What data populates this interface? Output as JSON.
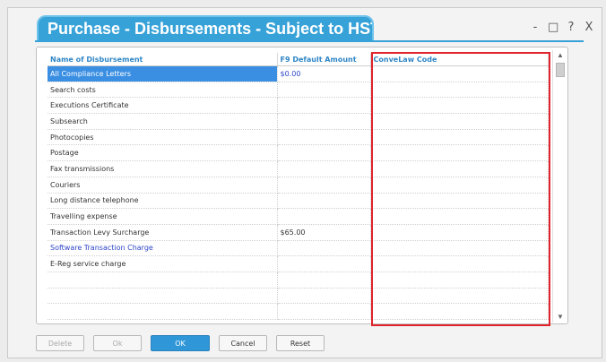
{
  "window": {
    "title": "Purchase - Disbursements - Subject to HST",
    "controls": [
      "-",
      "□",
      "?",
      "X"
    ]
  },
  "table": {
    "headers": [
      "Name of Disbursement",
      "F9 Default Amount",
      "ConveLaw Code"
    ],
    "rows": [
      {
        "name": "All Compliance Letters",
        "amount": "$0.00",
        "code": ""
      },
      {
        "name": "Search costs",
        "amount": "",
        "code": ""
      },
      {
        "name": "Executions Certificate",
        "amount": "",
        "code": ""
      },
      {
        "name": "Subsearch",
        "amount": "",
        "code": ""
      },
      {
        "name": "Photocopies",
        "amount": "",
        "code": ""
      },
      {
        "name": "Postage",
        "amount": "",
        "code": ""
      },
      {
        "name": "Fax transmissions",
        "amount": "",
        "code": ""
      },
      {
        "name": "Couriers",
        "amount": "",
        "code": ""
      },
      {
        "name": "Long distance telephone",
        "amount": "",
        "code": ""
      },
      {
        "name": "Travelling expense",
        "amount": "",
        "code": ""
      },
      {
        "name": "Transaction Levy Surcharge",
        "amount": "$65.00",
        "code": ""
      },
      {
        "name": "Software Transaction Charge",
        "amount": "",
        "code": ""
      },
      {
        "name": "E-Reg service charge",
        "amount": "",
        "code": ""
      },
      {
        "name": "",
        "amount": "",
        "code": ""
      },
      {
        "name": "",
        "amount": "",
        "code": ""
      },
      {
        "name": "",
        "amount": "",
        "code": ""
      }
    ]
  },
  "scrollbar": {
    "up": "▲",
    "down": "▼"
  },
  "buttons": {
    "delete": "Delete",
    "ok_disabled": "Ok",
    "ok": "OK",
    "cancel": "Cancel",
    "reset": "Reset"
  },
  "colors": {
    "accent": "#37a2d8",
    "selection": "#3b8fe3",
    "highlight": "#e0232c",
    "link_text": "#2d46c9"
  }
}
